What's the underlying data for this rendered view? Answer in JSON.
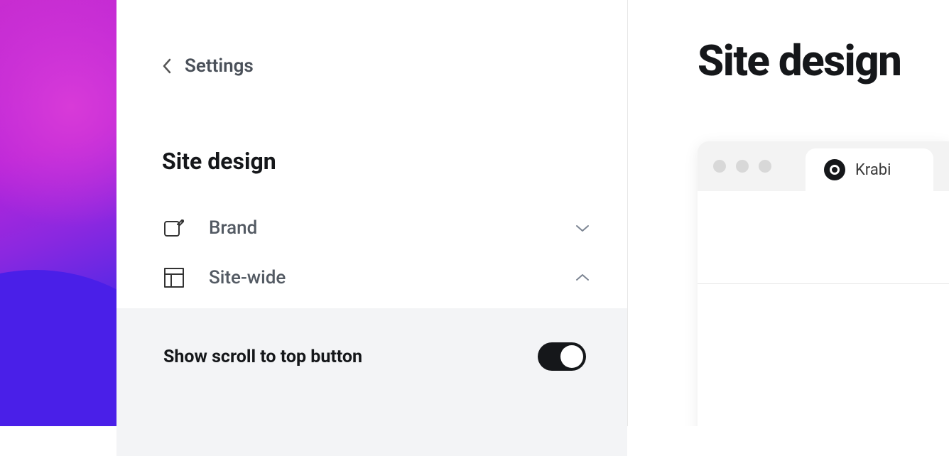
{
  "navigation": {
    "back_label": "Settings"
  },
  "sidebar": {
    "section_title": "Site design",
    "items": [
      {
        "label": "Brand",
        "expanded": false
      },
      {
        "label": "Site-wide",
        "expanded": true
      }
    ]
  },
  "options": {
    "scroll_to_top": {
      "label": "Show scroll to top button",
      "enabled": true
    }
  },
  "preview": {
    "title": "Site design",
    "tab_label": "Krabi"
  }
}
